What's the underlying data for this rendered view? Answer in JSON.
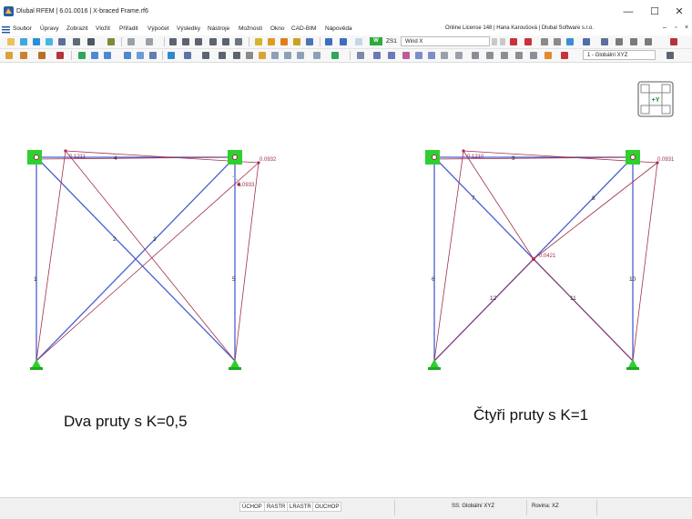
{
  "window": {
    "title": "Dlubal RFEM | 6.01.0016 | X-braced Frame.rf6",
    "minimize": "—",
    "maximize": "☐",
    "close": "✕"
  },
  "menu": {
    "items": [
      "Soubor",
      "Úpravy",
      "Zobrazit",
      "Vložit",
      "Přiřadit",
      "Výpočet",
      "Výsledky",
      "Nástroje",
      "Možnosti",
      "Okno",
      "CAD-BIM",
      "Nápověda"
    ],
    "license": "Online License 148 | Hana Karoušová | Dlubal Software s.r.o."
  },
  "toolbar": {
    "loadcase_badge": "W",
    "loadcase_id": "ZS1",
    "loadcase_name": "Wind X",
    "coord_system": "1 - Globální XYZ"
  },
  "view_cube": {
    "label": "+Y"
  },
  "colors": {
    "member_blue": "#4a5fd0",
    "member_red": "#a0304a",
    "support_green": "#2fcf2f"
  },
  "model_left": {
    "caption": "Dva pruty s K=0,5",
    "member_numbers": [
      "1",
      "4",
      "5",
      "2",
      "3"
    ],
    "values": [
      "0.1211",
      "0.0932",
      "0.0933"
    ]
  },
  "model_right": {
    "caption": "Čtyři pruty s K=1",
    "member_numbers": [
      "6",
      "9",
      "10",
      "7",
      "8",
      "12",
      "11"
    ],
    "values": [
      "0.1210",
      "0.0931",
      "0.0421"
    ]
  },
  "status": {
    "buttons": [
      "ÚCHOP",
      "RASTR",
      "LRASTR",
      "OUCHOP"
    ],
    "coord_system": "SS: Globální XYZ",
    "plane": "Rovina: XZ"
  }
}
